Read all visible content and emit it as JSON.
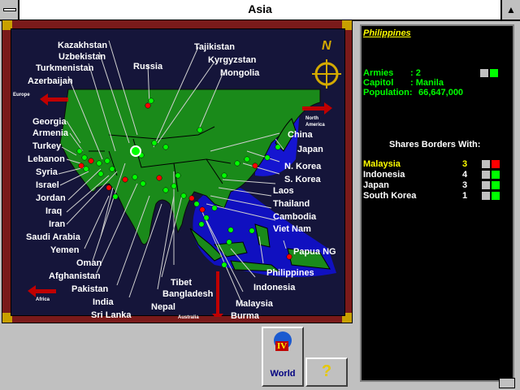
{
  "window": {
    "title": "Asia"
  },
  "map": {
    "edge_labels": {
      "europe": "Europe",
      "north_america": "North\nAmerica",
      "africa": "Africa",
      "australia": "Australia"
    },
    "compass_letter": "N",
    "countries": [
      "Kazakhstan",
      "Uzbekistan",
      "Turkmenistan",
      "Azerbaijan",
      "Russia",
      "Tajikistan",
      "Kyrgyzstan",
      "Mongolia",
      "Georgia",
      "Armenia",
      "Turkey",
      "Lebanon",
      "Syria",
      "Israel",
      "Jordan",
      "Iraq",
      "Iran",
      "Saudi Arabia",
      "Yemen",
      "Oman",
      "Afghanistan",
      "Pakistan",
      "India",
      "Sri Lanka",
      "Nepal",
      "Bangladesh",
      "Tibet",
      "Burma",
      "Malaysia",
      "Indonesia",
      "Philippines",
      "Papua NG",
      "Viet Nam",
      "Cambodia",
      "Thailand",
      "Laos",
      "S. Korea",
      "N. Korea",
      "Japan",
      "China"
    ]
  },
  "panel": {
    "selected_country": "Philippines",
    "armies_label": "Armies",
    "armies_value": ": 2",
    "capital_label": "Capitol",
    "capital_value": ": Manila",
    "population_label": "Population:",
    "population_value": "66,647,000",
    "borders_heading": "Shares Borders With:",
    "borders": [
      {
        "country": "Malaysia",
        "armies": "3",
        "highlight": true,
        "owner_color": "#ff0000"
      },
      {
        "country": "Indonesia",
        "armies": "4",
        "highlight": false,
        "owner_color": "#00ff00"
      },
      {
        "country": "Japan",
        "armies": "3",
        "highlight": false,
        "owner_color": "#00ff00"
      },
      {
        "country": "South Korea",
        "armies": "1",
        "highlight": false,
        "owner_color": "#00ff00"
      }
    ]
  },
  "buttons": {
    "world_label": "World",
    "help_label": "?",
    "world_badge": "IV"
  },
  "colors": {
    "player": "#00ff00",
    "enemy": "#ff0000",
    "land": "#1a8a1a",
    "sea": "#1515d0",
    "text_green": "#00ff00",
    "highlight_yellow": "#ffff00"
  }
}
